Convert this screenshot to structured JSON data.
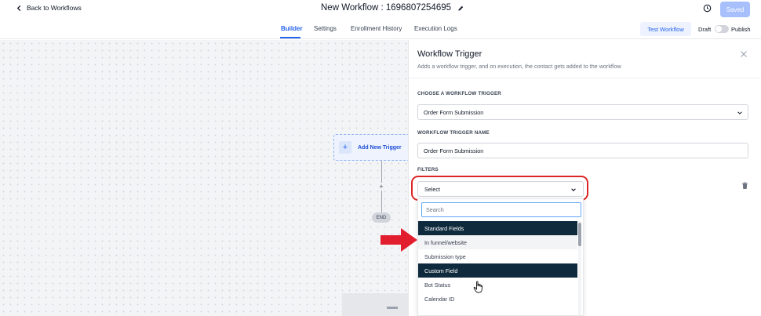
{
  "header": {
    "back_label": "Back to Workflows",
    "workflow_title": "New Workflow : 1696807254695",
    "saved_label": "Saved"
  },
  "tabs": [
    {
      "label": "Builder",
      "active": true
    },
    {
      "label": "Settings",
      "active": false
    },
    {
      "label": "Enrollment History",
      "active": false
    },
    {
      "label": "Execution Logs",
      "active": false
    }
  ],
  "actions": {
    "test_label": "Test Workflow",
    "draft_label": "Draft",
    "publish_label": "Publish",
    "published": false
  },
  "canvas": {
    "add_trigger_label": "Add New Trigger",
    "end_label": "END"
  },
  "panel": {
    "title": "Workflow Trigger",
    "description": "Adds a workflow trigger, and on execution, the contact gets added to the workflow",
    "choose_trigger_label": "CHOOSE A WORKFLOW TRIGGER",
    "trigger_value": "Order Form Submission",
    "trigger_name_label": "WORKFLOW TRIGGER NAME",
    "trigger_name_value": "Order Form Submission",
    "filters_label": "FILTERS",
    "filter_select_value": "Select",
    "search_placeholder": "Search",
    "options": [
      {
        "label": "Standard Fields",
        "group": true
      },
      {
        "label": "In funnel/website",
        "group": false,
        "hover": true
      },
      {
        "label": "Submission type",
        "group": false
      },
      {
        "label": "Custom Field",
        "group": true
      },
      {
        "label": "Bot Status",
        "group": false
      },
      {
        "label": "Calendar ID",
        "group": false
      }
    ]
  },
  "colors": {
    "accent": "#2563eb",
    "group_header": "#0f2a3d",
    "annotation_red": "#dc2626",
    "saved_button": "#a7bffb"
  }
}
